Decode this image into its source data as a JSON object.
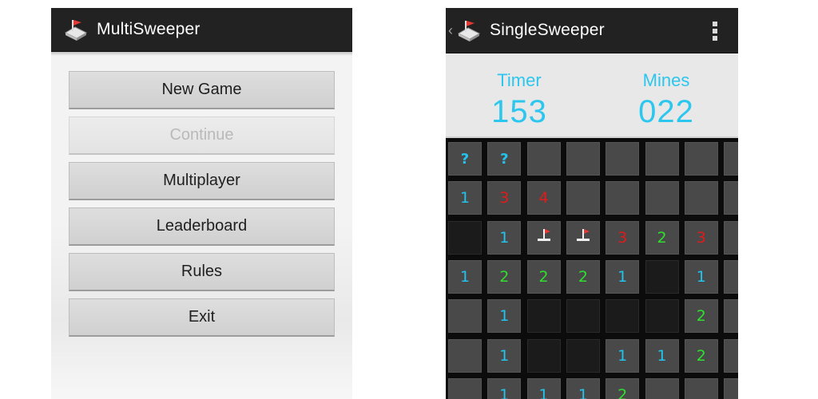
{
  "left_screen": {
    "app_title": "MultiSweeper",
    "app_icon": "minesweeper-flag-icon",
    "menu": [
      {
        "label": "New Game",
        "enabled": true
      },
      {
        "label": "Continue",
        "enabled": false
      },
      {
        "label": "Multiplayer",
        "enabled": true
      },
      {
        "label": "Leaderboard",
        "enabled": true
      },
      {
        "label": "Rules",
        "enabled": true
      },
      {
        "label": "Exit",
        "enabled": true
      }
    ]
  },
  "right_screen": {
    "app_title": "SingleSweeper",
    "app_icon": "minesweeper-flag-icon",
    "up_icon": "back-caret-icon",
    "overflow_icon": "overflow-menu-icon",
    "timer_label": "Timer",
    "timer_value": "153",
    "mines_label": "Mines",
    "mines_value": "022",
    "colors": {
      "cyan": "#22c4ee",
      "green": "#2ee02e",
      "red": "#e01b1b"
    },
    "legend": {
      "U": "unrevealed",
      "E": "revealed-empty",
      "F": "flag",
      "?": "question",
      "digit": "adjacent-mine-count"
    },
    "board": [
      [
        "?",
        "?",
        "U",
        "U",
        "U",
        "U",
        "U",
        "U"
      ],
      [
        "1",
        "3",
        "4",
        "U",
        "U",
        "U",
        "U",
        "U"
      ],
      [
        "E",
        "1",
        "F",
        "F",
        "3",
        "2",
        "3",
        "U"
      ],
      [
        "1",
        "2",
        "2",
        "2",
        "1",
        "E",
        "1",
        "U"
      ],
      [
        "U",
        "1",
        "E",
        "E",
        "E",
        "E",
        "2",
        "U"
      ],
      [
        "U",
        "1",
        "E",
        "E",
        "1",
        "1",
        "2",
        "U"
      ],
      [
        "U",
        "1",
        "1",
        "1",
        "2",
        "U",
        "U",
        "U"
      ]
    ]
  }
}
